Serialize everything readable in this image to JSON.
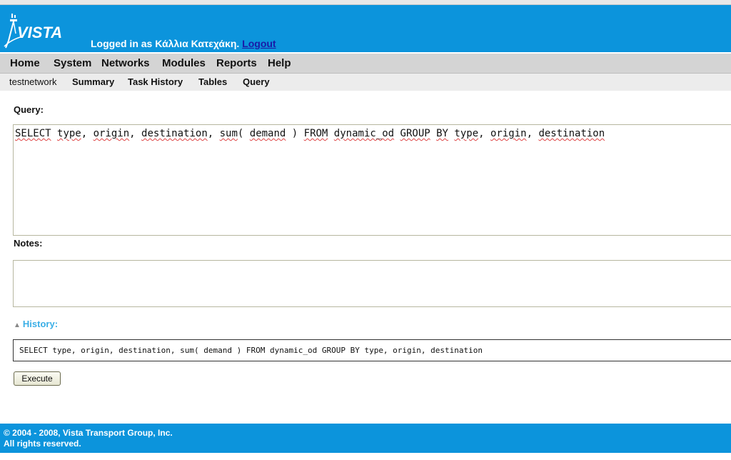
{
  "header": {
    "logo_text": "VISTA",
    "login_prefix": "Logged in as Κάλλια Κατεχάκη.",
    "logout_label": "Logout",
    "bg_color": "#0c94dc"
  },
  "main_nav": [
    "Home",
    "System",
    "Networks",
    "Modules",
    "Reports",
    "Help"
  ],
  "sub_nav": {
    "network": "testnetwork",
    "items": [
      "Summary",
      "Task History",
      "Tables",
      "Query"
    ]
  },
  "query": {
    "label": "Query:",
    "tokens": [
      "SELECT",
      " ",
      "type",
      ", ",
      "origin",
      ", ",
      "destination",
      ", ",
      "sum",
      "( ",
      "demand",
      " ) ",
      "FROM",
      " ",
      "dynamic_od",
      " ",
      "GROUP",
      " ",
      "BY",
      " ",
      "type",
      ", ",
      "origin",
      ", ",
      "destination"
    ]
  },
  "notes": {
    "label": "Notes:",
    "value": ""
  },
  "history": {
    "label": "History:",
    "entries": [
      "SELECT type, origin, destination, sum( demand ) FROM dynamic_od GROUP BY type, origin, destination"
    ]
  },
  "execute_label": "Execute",
  "footer": {
    "line1": "© 2004 - 2008, Vista Transport Group, Inc.",
    "line2": "All rights reserved."
  }
}
